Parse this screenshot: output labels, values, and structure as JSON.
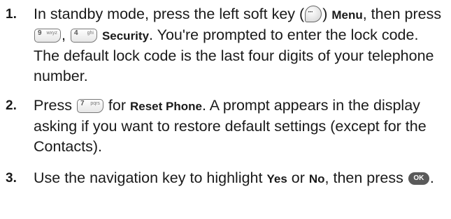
{
  "steps": [
    {
      "number": "1.",
      "t1": "In standby mode, press the left soft key (",
      "t2": ") ",
      "menu": "Menu",
      "t3": ", then press ",
      "t4": ", ",
      "security": "Security",
      "t5": ". You're prompted to enter the lock code. The default lock code is the last four digits of your telephone number."
    },
    {
      "number": "2.",
      "t1": "Press ",
      "t2": " for ",
      "reset": "Reset Phone",
      "t3": ". A prompt appears in the display asking if you want to restore default settings (except for the Contacts)."
    },
    {
      "number": "3.",
      "t1": "Use the navigation key to highlight ",
      "yes": "Yes",
      "t2": " or ",
      "no": "No",
      "t3": ", then press ",
      "t4": "."
    }
  ],
  "keys": {
    "softkey_glyph": "···",
    "key9_number": "9",
    "key9_letters": "wxyz",
    "key4_number": "4",
    "key4_letters": "ghi",
    "key7_number": "7",
    "key7_letters": "pqrs",
    "ok_label": "OK"
  },
  "icons": {
    "softkey": "left-soft-key-icon",
    "key9": "key-9-icon",
    "key4": "key-4-icon",
    "key7": "key-7-icon",
    "ok": "ok-key-icon"
  }
}
